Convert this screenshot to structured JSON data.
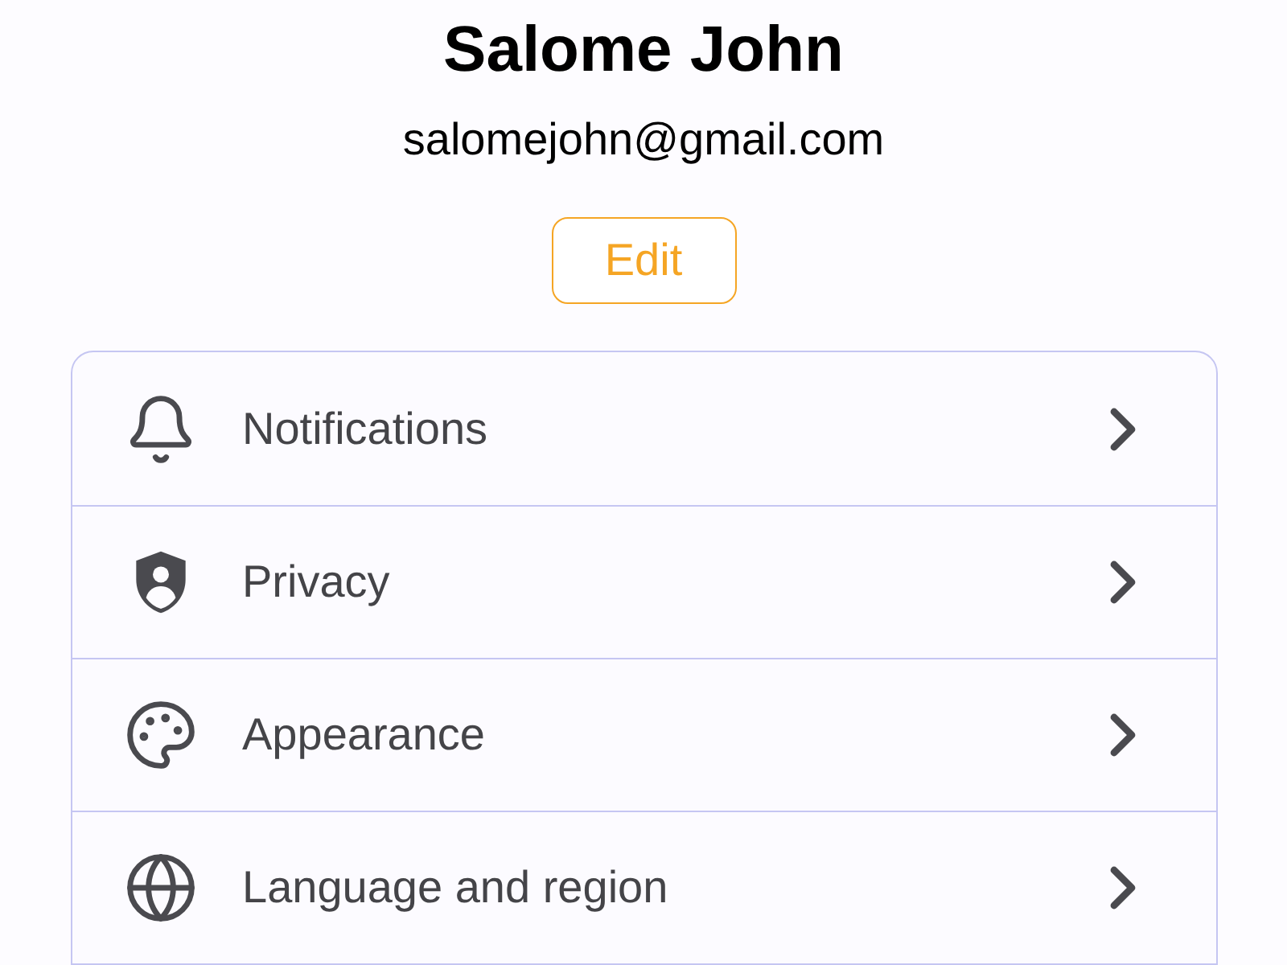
{
  "profile": {
    "name": "Salome John",
    "email": "salomejohn@gmail.com",
    "edit_button": "Edit"
  },
  "settings": [
    {
      "label": "Notifications"
    },
    {
      "label": "Privacy"
    },
    {
      "label": "Appearance"
    },
    {
      "label": "Language and region"
    }
  ]
}
